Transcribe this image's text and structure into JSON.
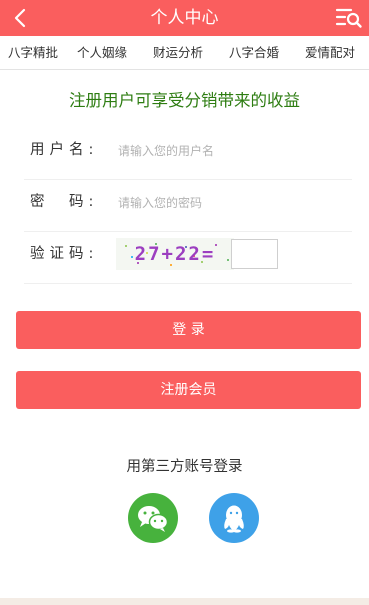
{
  "header": {
    "title": "个人中心",
    "back_icon": "chevron-left-icon",
    "menu_icon": "menu-search-icon",
    "bg_color": "#fa5e5e"
  },
  "tabs": [
    "八字精批",
    "个人姻缘",
    "财运分析",
    "八字合婚",
    "爱情配对"
  ],
  "headline": "注册用户可享受分销带来的收益",
  "form": {
    "username": {
      "label": "用户名:",
      "placeholder": "请输入您的用户名"
    },
    "password": {
      "label": "密　码:",
      "placeholder": "请输入您的密码"
    },
    "captcha": {
      "label": "验证码:",
      "text": "27+22="
    }
  },
  "buttons": {
    "login": "登 录",
    "register": "注册会员"
  },
  "third_party": {
    "title": "用第三方账号登录",
    "icons": [
      "wechat-icon",
      "qq-icon"
    ]
  }
}
